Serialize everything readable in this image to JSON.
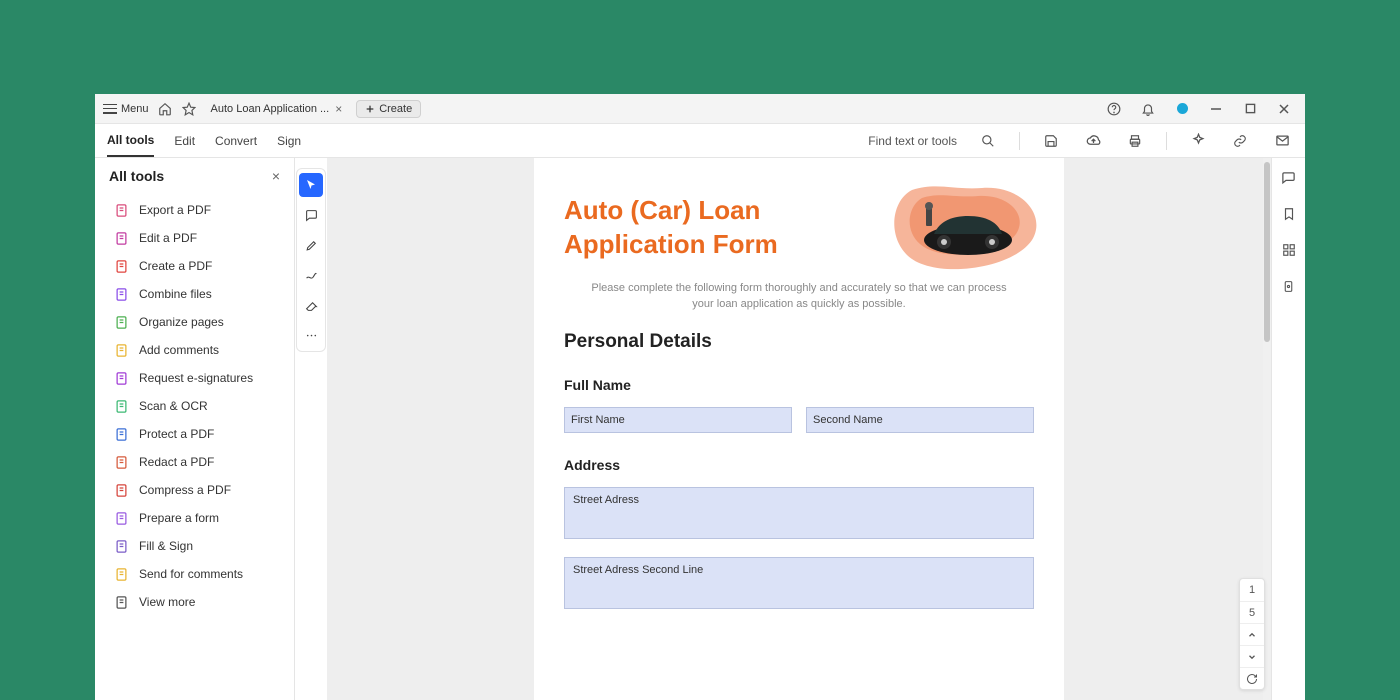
{
  "titlebar": {
    "menu_label": "Menu",
    "tab_label": "Auto Loan Application ...",
    "create_label": "Create"
  },
  "toolbar": {
    "tabs": [
      "All tools",
      "Edit",
      "Convert",
      "Sign"
    ],
    "find_label": "Find text or tools"
  },
  "leftpanel": {
    "title": "All tools",
    "items": [
      {
        "label": "Export a PDF",
        "icon": "export-pdf-icon",
        "color": "#d94b7b"
      },
      {
        "label": "Edit a PDF",
        "icon": "edit-pdf-icon",
        "color": "#c23ba0"
      },
      {
        "label": "Create a PDF",
        "icon": "create-pdf-icon",
        "color": "#e0443e"
      },
      {
        "label": "Combine files",
        "icon": "combine-files-icon",
        "color": "#8a4de8"
      },
      {
        "label": "Organize pages",
        "icon": "organize-pages-icon",
        "color": "#4caf50"
      },
      {
        "label": "Add comments",
        "icon": "add-comments-icon",
        "color": "#e8b431"
      },
      {
        "label": "Request e-signatures",
        "icon": "request-esign-icon",
        "color": "#a03bd6"
      },
      {
        "label": "Scan & OCR",
        "icon": "scan-ocr-icon",
        "color": "#3bb873"
      },
      {
        "label": "Protect a PDF",
        "icon": "protect-pdf-icon",
        "color": "#3b6fd6"
      },
      {
        "label": "Redact a PDF",
        "icon": "redact-pdf-icon",
        "color": "#d65a3b"
      },
      {
        "label": "Compress a PDF",
        "icon": "compress-pdf-icon",
        "color": "#d6443b"
      },
      {
        "label": "Prepare a form",
        "icon": "prepare-form-icon",
        "color": "#985ae0"
      },
      {
        "label": "Fill & Sign",
        "icon": "fill-sign-icon",
        "color": "#7a5cc7"
      },
      {
        "label": "Send for comments",
        "icon": "send-comments-icon",
        "color": "#e8b431"
      },
      {
        "label": "View more",
        "icon": "view-more-icon",
        "color": "#555"
      }
    ]
  },
  "document": {
    "title_line1": "Auto (Car) Loan",
    "title_line2": "Application Form",
    "intro": "Please complete the following form thoroughly and accurately so that we can process your loan application as quickly as possible.",
    "section1": "Personal Details",
    "label_fullname": "Full Name",
    "label_address": "Address",
    "ph_firstname": "First Name",
    "ph_secondname": "Second Name",
    "ph_street1": "Street Adress",
    "ph_street2": "Street Adress Second Line"
  },
  "pagenav": {
    "current": "1",
    "total": "5"
  }
}
